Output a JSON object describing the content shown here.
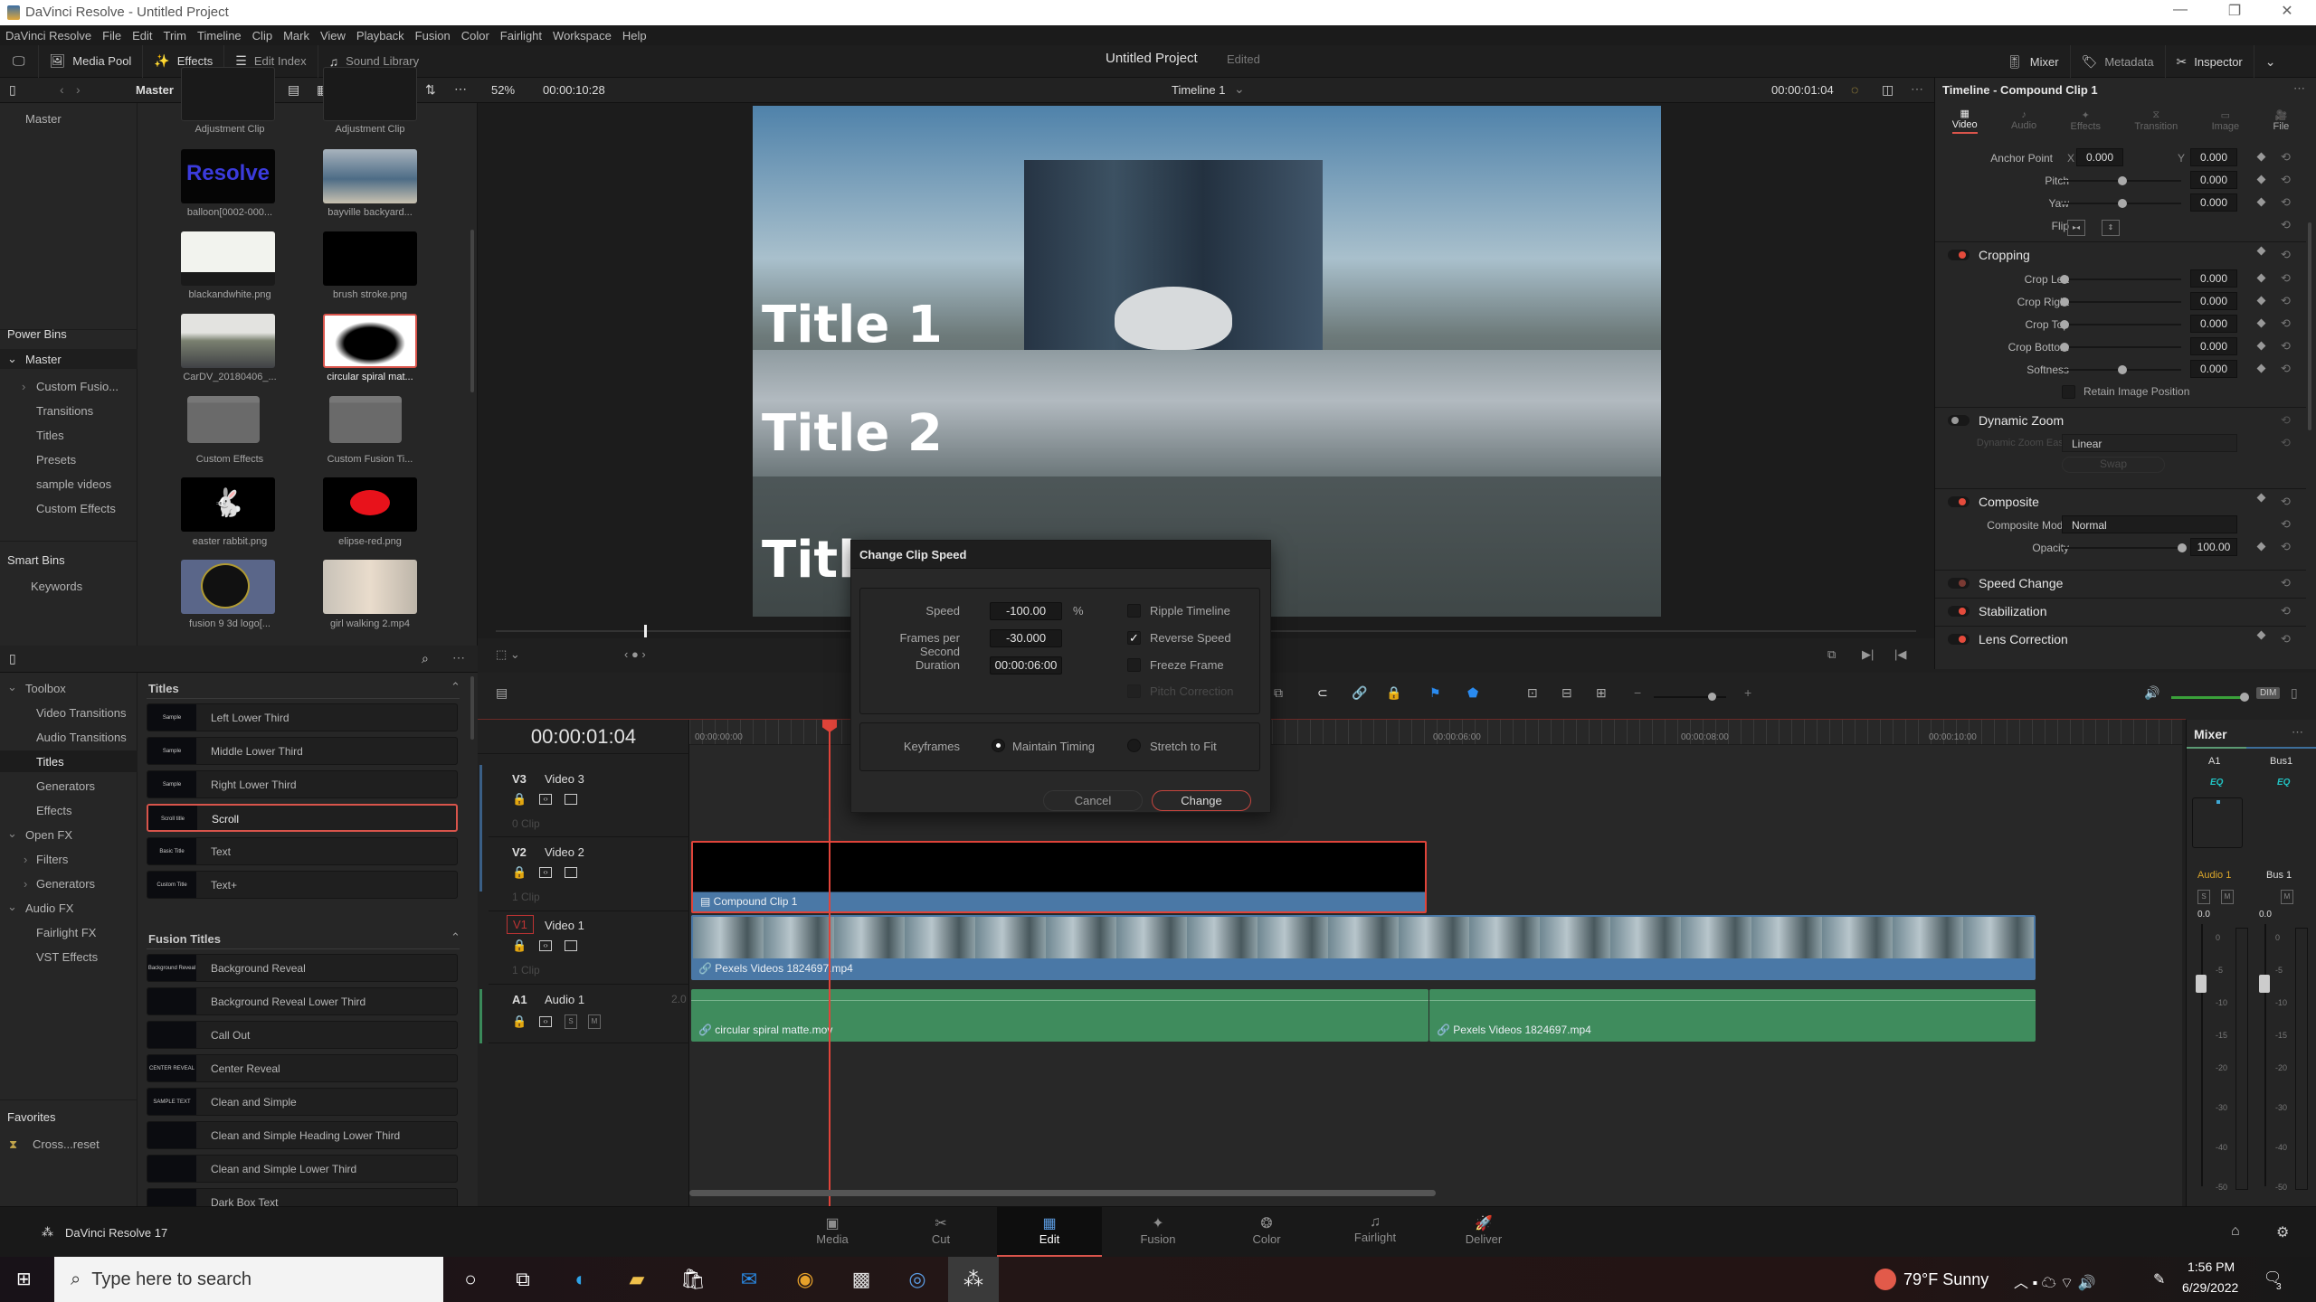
{
  "window": {
    "title": "DaVinci Resolve - Untitled Project",
    "controls": [
      "—",
      "❐",
      "✕"
    ]
  },
  "menu": [
    "DaVinci Resolve",
    "File",
    "Edit",
    "Trim",
    "Timeline",
    "Clip",
    "Mark",
    "View",
    "Playback",
    "Fusion",
    "Color",
    "Fairlight",
    "Workspace",
    "Help"
  ],
  "toolbar": {
    "media_pool": "Media Pool",
    "effects": "Effects",
    "edit_index": "Edit Index",
    "sound_library": "Sound Library",
    "project_title": "Untitled Project",
    "project_status": "Edited",
    "mixer": "Mixer",
    "metadata": "Metadata",
    "inspector": "Inspector"
  },
  "subbar": {
    "bin_name": "Master",
    "zoom": "52%",
    "source_timecode": "00:00:10:28",
    "timeline_name": "Timeline 1",
    "record_timecode": "00:00:01:04"
  },
  "bins": {
    "master_label": "Master",
    "power_bins": "Power Bins",
    "power_master": "Master",
    "power_items": [
      "Custom Fusio...",
      "Transitions",
      "Titles",
      "Presets",
      "sample videos",
      "Custom Effects"
    ],
    "smart_bins": "Smart Bins",
    "smart_items": [
      "Keywords"
    ]
  },
  "media_pool": {
    "clips": [
      {
        "name": "Adjustment Clip"
      },
      {
        "name": "Adjustment Clip"
      },
      {
        "name": "balloon[0002-000..."
      },
      {
        "name": "bayville backyard..."
      },
      {
        "name": "blackandwhite.png"
      },
      {
        "name": "brush stroke.png"
      },
      {
        "name": "CarDV_20180406_..."
      },
      {
        "name": "circular spiral mat..."
      },
      {
        "name": "Custom Effects"
      },
      {
        "name": "Custom Fusion Ti..."
      },
      {
        "name": "easter rabbit.png"
      },
      {
        "name": "elipse-red.png"
      },
      {
        "name": "fusion 9 3d logo[..."
      },
      {
        "name": "girl walking 2.mp4"
      }
    ],
    "balloon_text": "Resolve"
  },
  "viewer": {
    "titles": [
      "Title 1",
      "Title 2",
      "Title"
    ]
  },
  "inspector": {
    "header": "Timeline - Compound Clip 1",
    "tabs": [
      "Video",
      "Audio",
      "Effects",
      "Transition",
      "Image",
      "File"
    ],
    "active_tab": "Video",
    "anchor": {
      "label": "Anchor Point",
      "x_label": "X",
      "x": "0.000",
      "y_label": "Y",
      "y": "0.000"
    },
    "pitch": {
      "label": "Pitch",
      "value": "0.000"
    },
    "yaw": {
      "label": "Yaw",
      "value": "0.000"
    },
    "flip": {
      "label": "Flip"
    },
    "cropping": {
      "title": "Cropping",
      "crop_left": {
        "label": "Crop Left",
        "value": "0.000"
      },
      "crop_right": {
        "label": "Crop Right",
        "value": "0.000"
      },
      "crop_top": {
        "label": "Crop Top",
        "value": "0.000"
      },
      "crop_bottom": {
        "label": "Crop Bottom",
        "value": "0.000"
      },
      "softness": {
        "label": "Softness",
        "value": "0.000"
      },
      "retain": "Retain Image Position"
    },
    "dynamic_zoom": {
      "title": "Dynamic Zoom",
      "ease_label": "Dynamic Zoom Ease",
      "ease": "Linear",
      "swap": "Swap"
    },
    "composite": {
      "title": "Composite",
      "mode_label": "Composite Mode",
      "mode": "Normal",
      "opacity_label": "Opacity",
      "opacity": "100.00"
    },
    "speed_change": "Speed Change",
    "stabilization": "Stabilization",
    "lens_correction": "Lens Correction"
  },
  "effects_library": {
    "tree": {
      "toolbox": "Toolbox",
      "toolbox_items": [
        "Video Transitions",
        "Audio Transitions",
        "Titles",
        "Generators",
        "Effects"
      ],
      "open_fx": "Open FX",
      "open_fx_items": [
        "Filters",
        "Generators"
      ],
      "audio_fx": "Audio FX",
      "audio_fx_items": [
        "Fairlight FX",
        "VST Effects"
      ],
      "favorites": "Favorites",
      "favorite_items": [
        "Cross...reset"
      ]
    },
    "titles_group": "Titles",
    "titles": [
      {
        "label": "Left Lower Third",
        "thumb": "Sample"
      },
      {
        "label": "Middle Lower Third",
        "thumb": "Sample"
      },
      {
        "label": "Right Lower Third",
        "thumb": "Sample"
      },
      {
        "label": "Scroll",
        "thumb": "Scroll title"
      },
      {
        "label": "Text",
        "thumb": "Basic Title"
      },
      {
        "label": "Text+",
        "thumb": "Custom Title"
      }
    ],
    "fusion_group": "Fusion Titles",
    "fusion_titles": [
      {
        "label": "Background Reveal",
        "thumb": "Background Reveal"
      },
      {
        "label": "Background Reveal Lower Third",
        "thumb": ""
      },
      {
        "label": "Call Out",
        "thumb": ""
      },
      {
        "label": "Center Reveal",
        "thumb": "CENTER REVEAL"
      },
      {
        "label": "Clean and Simple",
        "thumb": "SAMPLE TEXT"
      },
      {
        "label": "Clean and Simple Heading Lower Third",
        "thumb": ""
      },
      {
        "label": "Clean and Simple Lower Third",
        "thumb": ""
      },
      {
        "label": "Dark Box Text",
        "thumb": ""
      }
    ]
  },
  "timeline": {
    "timecode": "00:00:01:04",
    "ruler": [
      "00:00:00:00",
      "00:00:06:00",
      "00:00:08:00",
      "00:00:10:00"
    ],
    "tracks": [
      {
        "tag": "V3",
        "name": "Video 3",
        "clips": "0 Clip"
      },
      {
        "tag": "V2",
        "name": "Video 2",
        "clips": "1 Clip"
      },
      {
        "tag": "V1",
        "name": "Video 1",
        "clips": "1 Clip"
      },
      {
        "tag": "A1",
        "name": "Audio 1",
        "channels": "2.0"
      }
    ],
    "clip_v2": "Compound Clip 1",
    "clip_v1": "Pexels Videos 1824697.mp4",
    "clip_a1_left": "circular spiral matte.mov",
    "clip_a1_right": "Pexels Videos 1824697.mp4"
  },
  "dialog": {
    "title": "Change Clip Speed",
    "speed_label": "Speed",
    "speed": "-100.00",
    "speed_unit": "%",
    "fps_label": "Frames per Second",
    "fps": "-30.000",
    "duration_label": "Duration",
    "duration": "00:00:06:00",
    "ripple": "Ripple Timeline",
    "ripple_checked": false,
    "reverse": "Reverse Speed",
    "reverse_checked": true,
    "freeze": "Freeze Frame",
    "freeze_checked": false,
    "pitch": "Pitch Correction",
    "keyframes_label": "Keyframes",
    "maintain": "Maintain Timing",
    "stretch": "Stretch to Fit",
    "keyframes_selected": "Maintain Timing",
    "cancel": "Cancel",
    "change": "Change",
    "check_glyph": "✓"
  },
  "mixer": {
    "title": "Mixer",
    "channels": [
      "A1",
      "Bus1"
    ],
    "eq": "EQ",
    "strip_names": [
      "Audio 1",
      "Bus 1"
    ],
    "solo": "S",
    "mute": "M",
    "levels": [
      "0.0",
      "0.0"
    ],
    "scale": [
      "0",
      "-5",
      "-10",
      "-15",
      "-20",
      "-30",
      "-40",
      "-50"
    ],
    "dim": "DIM"
  },
  "pages": {
    "app_name": "DaVinci Resolve 17",
    "items": [
      "Media",
      "Cut",
      "Edit",
      "Fusion",
      "Color",
      "Fairlight",
      "Deliver"
    ],
    "active": "Edit"
  },
  "taskbar": {
    "search_placeholder": "Type here to search",
    "weather": "79°F  Sunny",
    "time": "1:56 PM",
    "date": "6/29/2022",
    "notifications": "3"
  },
  "colors": {
    "accent": "#d9544b",
    "video_clip": "#4a78a6",
    "audio_clip": "#3f8c5d",
    "playhead": "#e0443a"
  }
}
